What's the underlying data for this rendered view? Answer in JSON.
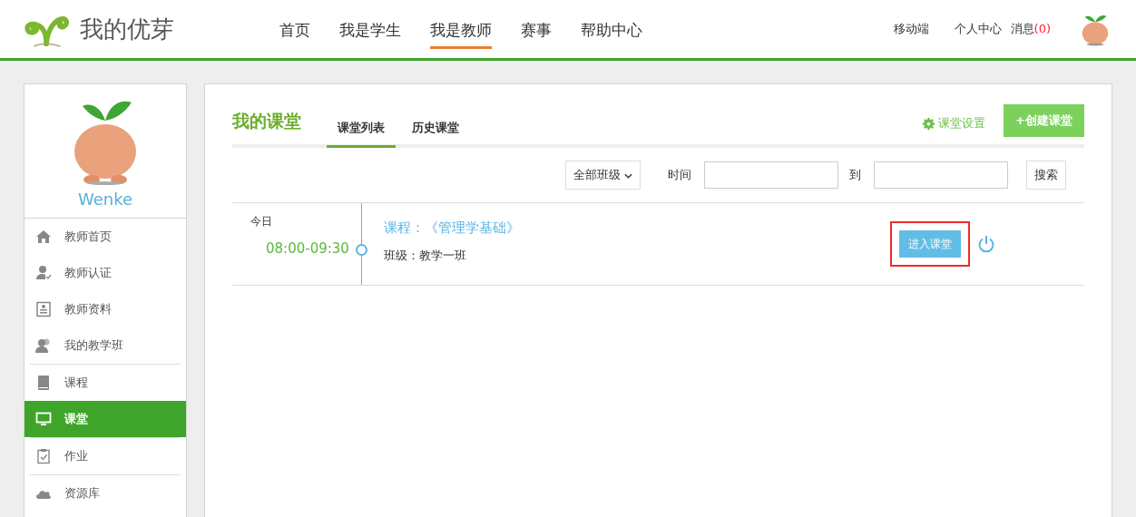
{
  "header": {
    "brand": "我的优芽",
    "nav": [
      {
        "label": "首页",
        "selected": false
      },
      {
        "label": "我是学生",
        "selected": false
      },
      {
        "label": "我是教师",
        "selected": true
      },
      {
        "label": "赛事",
        "selected": false
      },
      {
        "label": "帮助中心",
        "selected": false
      }
    ],
    "links": [
      {
        "label": "移动端"
      },
      {
        "label": "个人中心"
      }
    ],
    "messages": {
      "label": "消息",
      "count": "(0)"
    }
  },
  "sidebar": {
    "username": "Wenke",
    "groups": [
      {
        "items": [
          {
            "label": "教师首页",
            "kind": "home",
            "selected": false
          },
          {
            "label": "教师认证",
            "kind": "certify",
            "selected": false
          },
          {
            "label": "教师资料",
            "kind": "profile",
            "selected": false
          },
          {
            "label": "我的教学班",
            "kind": "classes",
            "selected": false
          }
        ]
      },
      {
        "items": [
          {
            "label": "课程",
            "kind": "courses",
            "selected": false
          },
          {
            "label": "课堂",
            "kind": "classroom",
            "selected": true
          }
        ]
      },
      {
        "items": [
          {
            "label": "作业",
            "kind": "homework",
            "selected": false
          }
        ]
      },
      {
        "items": [
          {
            "label": "资源库",
            "kind": "library",
            "selected": false
          }
        ]
      }
    ]
  },
  "main": {
    "title": "我的课堂",
    "tabs": [
      {
        "label": "课堂列表",
        "selected": true
      },
      {
        "label": "历史课堂",
        "selected": false
      }
    ],
    "settings": "课堂设置",
    "create": "+创建课堂",
    "filter": {
      "class_select": "全部班级",
      "time_label": "时间",
      "to_label": "到",
      "search": "搜索"
    },
    "sessions": [
      {
        "day": "今日",
        "time": "08:00-09:30",
        "course": "课程：《管理学基础》",
        "class": "班级：教学一班",
        "enter": "进入课堂",
        "highlighted": true
      }
    ]
  }
}
